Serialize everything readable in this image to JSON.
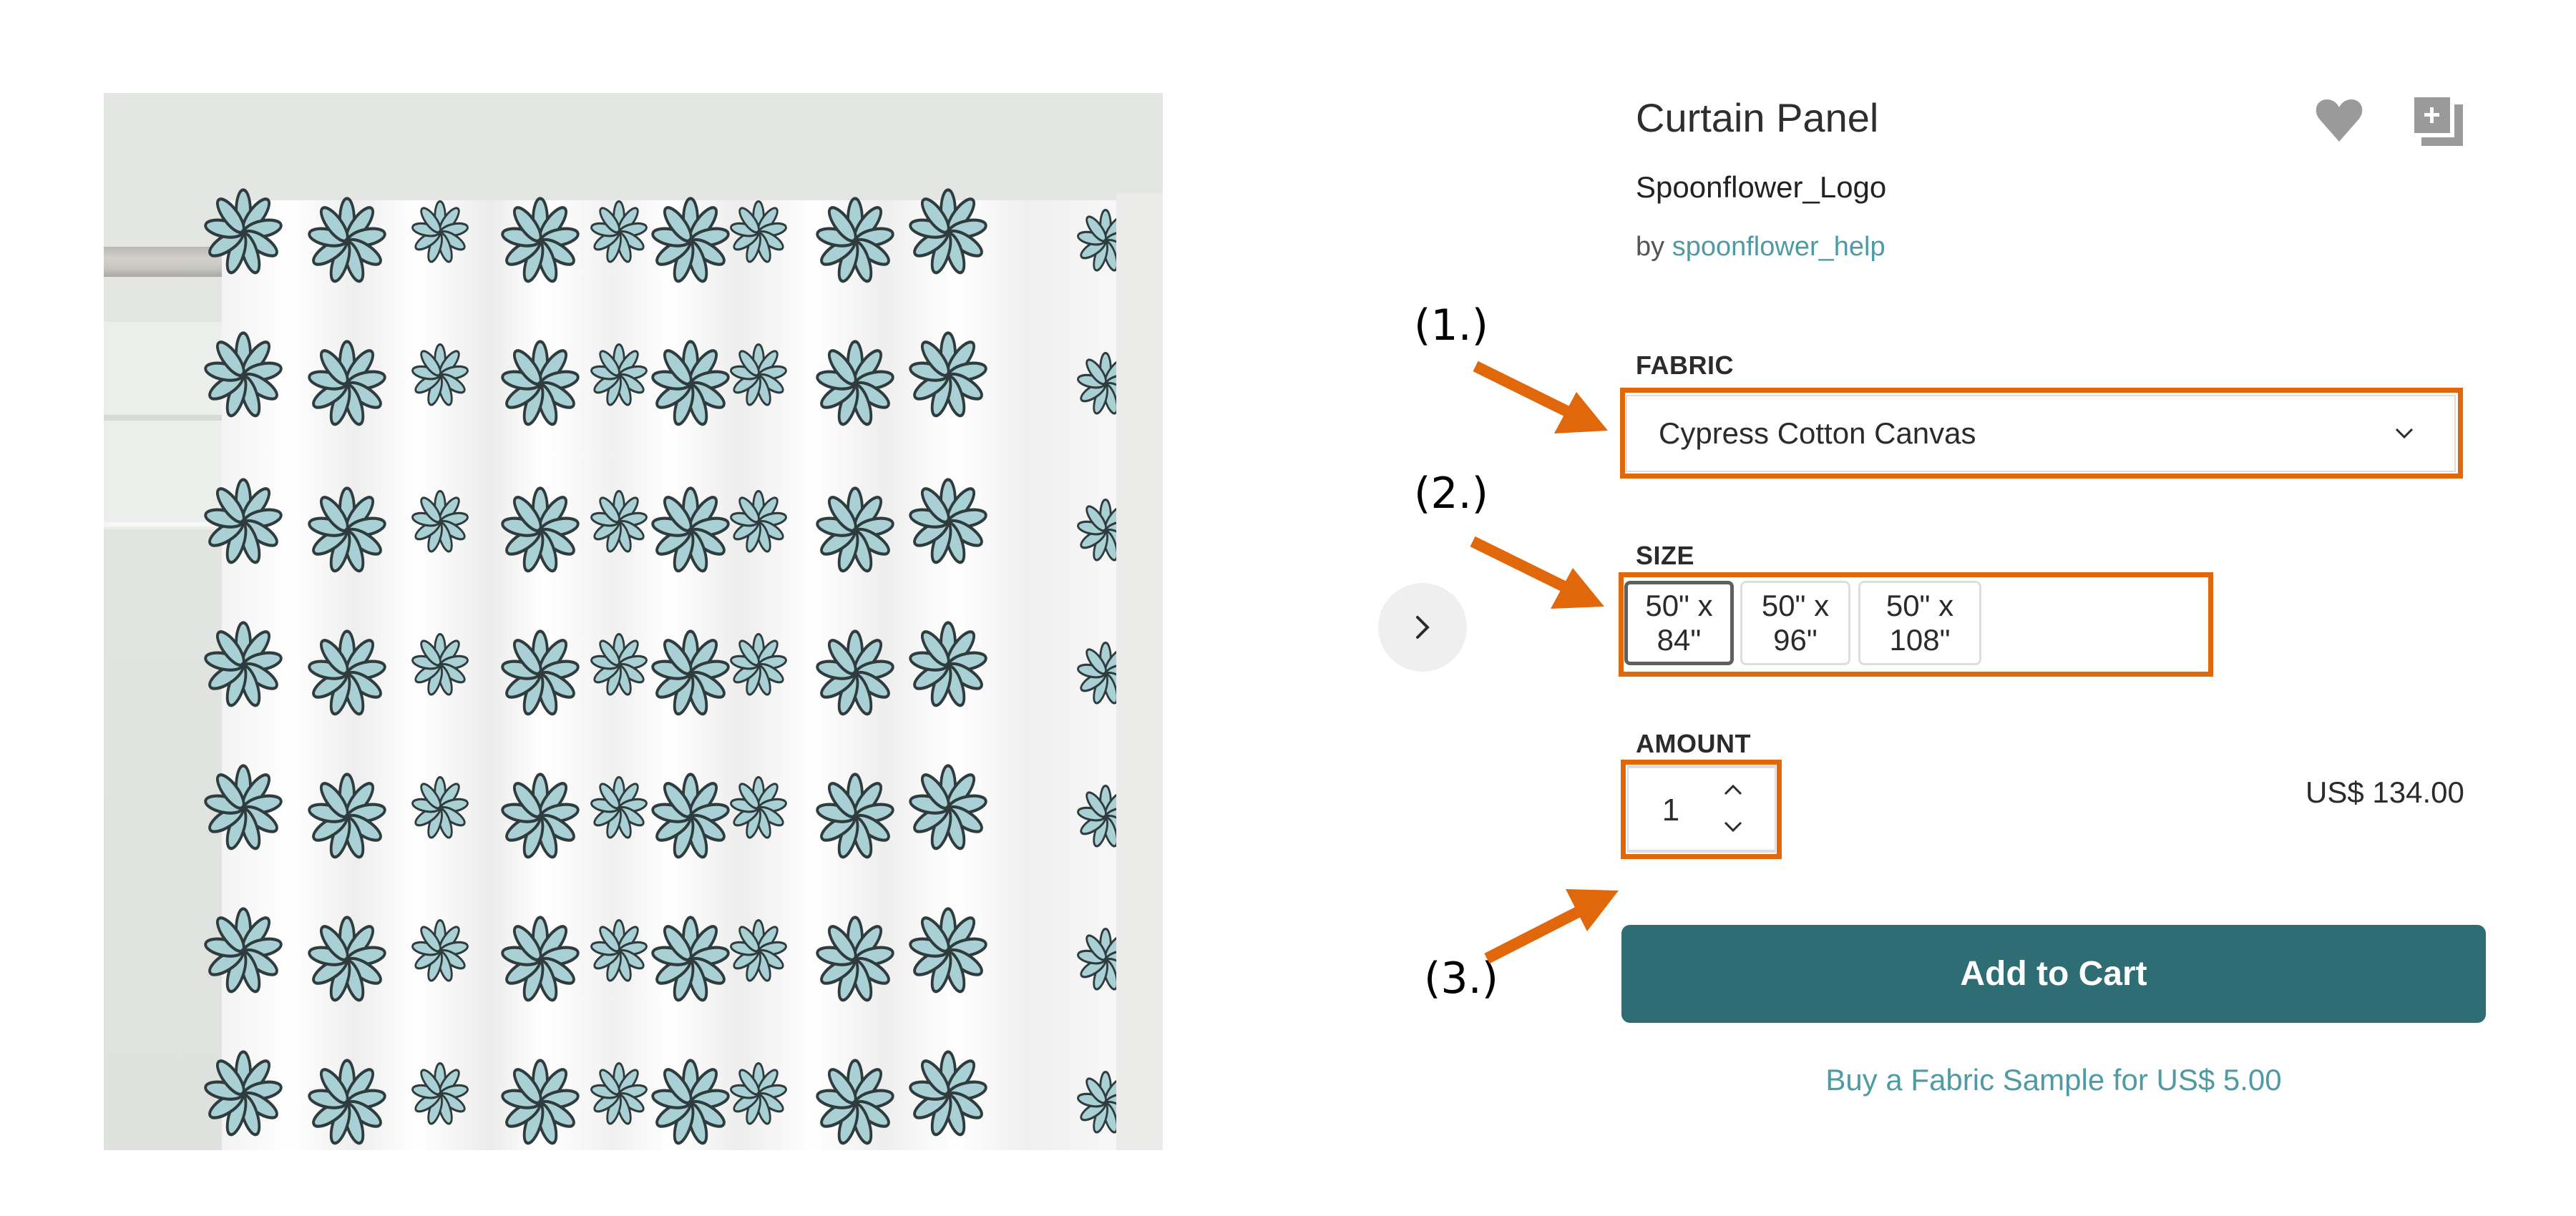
{
  "product": {
    "title": "Curtain Panel",
    "design_name": "Spoonflower_Logo",
    "designer_prefix": "by",
    "designer_name": "spoonflower_help"
  },
  "icons": {
    "favorite": "heart-icon",
    "add_to_collection": "add-to-collection-icon",
    "next": "chevron-right-icon",
    "dropdown": "chevron-down-icon",
    "increment": "chevron-up-icon",
    "decrement": "chevron-down-icon"
  },
  "fabric": {
    "label": "FABRIC",
    "selected": "Cypress Cotton Canvas"
  },
  "size": {
    "label": "SIZE",
    "options": [
      "50\" x 84\"",
      "50\" x 96\"",
      "50\" x 108\""
    ],
    "selected_index": 0
  },
  "amount": {
    "label": "AMOUNT",
    "value": "1"
  },
  "price": "US$ 134.00",
  "actions": {
    "add_to_cart": "Add to Cart",
    "sample_link": "Buy a Fabric Sample for US$ 5.00"
  },
  "annotations": {
    "labels": [
      "(1.)",
      "(2.)",
      "(3.)"
    ],
    "color": "#e0670a"
  },
  "colors": {
    "primary": "#2e6d74",
    "link": "#4f9aa3",
    "pattern_fill": "#a9d0d4",
    "pattern_outline": "#2f3b3d"
  }
}
